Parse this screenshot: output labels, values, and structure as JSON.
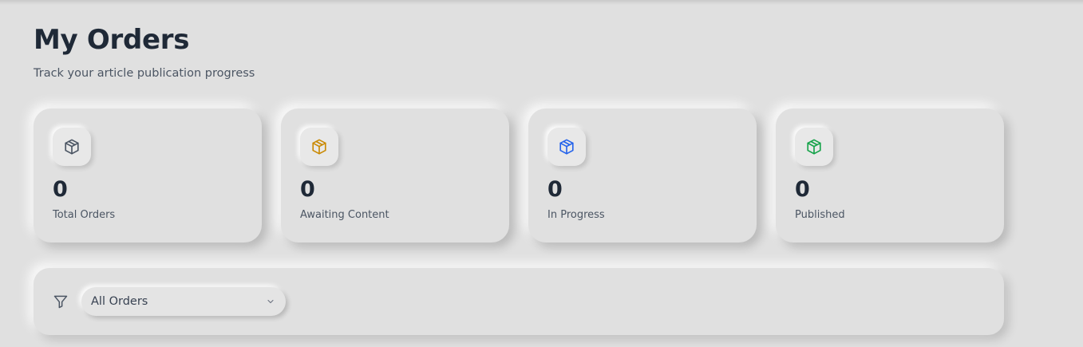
{
  "header": {
    "title": "My Orders",
    "subtitle": "Track your article publication progress"
  },
  "stats": [
    {
      "value": "0",
      "label": "Total Orders",
      "icon": "package-icon",
      "color": "#4b5563"
    },
    {
      "value": "0",
      "label": "Awaiting Content",
      "icon": "package-icon",
      "color": "#ca8a04"
    },
    {
      "value": "0",
      "label": "In Progress",
      "icon": "package-icon",
      "color": "#2563eb"
    },
    {
      "value": "0",
      "label": "Published",
      "icon": "package-icon",
      "color": "#16a34a"
    }
  ],
  "filter": {
    "icon": "filter-icon",
    "selected": "All Orders",
    "chevron": "chevron-down-icon"
  },
  "colors": {
    "background": "#e0e0e0",
    "text_primary": "#1f2937",
    "text_secondary": "#4b5563"
  }
}
